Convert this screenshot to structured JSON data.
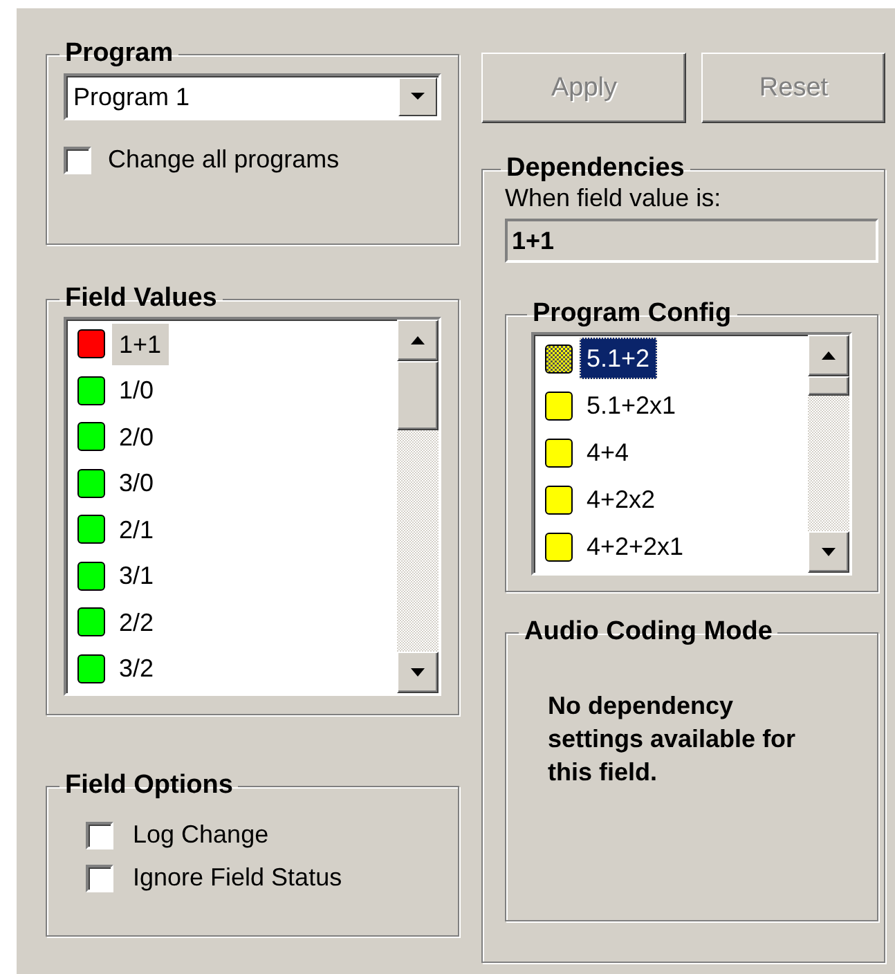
{
  "program": {
    "title": "Program",
    "dropdown_value": "Program 1",
    "change_all": {
      "label": "Change all programs",
      "checked": false
    }
  },
  "field_values": {
    "title": "Field Values",
    "items": [
      {
        "label": "1+1",
        "color": "#ff0000",
        "selected": true
      },
      {
        "label": "1/0",
        "color": "#00ff00",
        "selected": false
      },
      {
        "label": "2/0",
        "color": "#00ff00",
        "selected": false
      },
      {
        "label": "3/0",
        "color": "#00ff00",
        "selected": false
      },
      {
        "label": "2/1",
        "color": "#00ff00",
        "selected": false
      },
      {
        "label": "3/1",
        "color": "#00ff00",
        "selected": false
      },
      {
        "label": "2/2",
        "color": "#00ff00",
        "selected": false
      },
      {
        "label": "3/2",
        "color": "#00ff00",
        "selected": false
      }
    ]
  },
  "field_options": {
    "title": "Field Options",
    "options": [
      {
        "label": "Log Change",
        "checked": false
      },
      {
        "label": "Ignore Field Status",
        "checked": false
      }
    ]
  },
  "buttons": [
    {
      "label": "Apply",
      "disabled": true
    },
    {
      "label": "Reset",
      "disabled": true
    }
  ],
  "dependencies": {
    "title": "Dependencies",
    "field_label": "When field value is:",
    "field_value": "1+1",
    "program_config": {
      "title": "Program Config",
      "items": [
        {
          "label": "5.1+2",
          "color": "#ffff00",
          "selected": true
        },
        {
          "label": "5.1+2x1",
          "color": "#ffff00",
          "selected": false
        },
        {
          "label": "4+4",
          "color": "#ffff00",
          "selected": false
        },
        {
          "label": "4+2x2",
          "color": "#ffff00",
          "selected": false
        },
        {
          "label": "4+2+2x1",
          "color": "#ffff00",
          "selected": false
        }
      ]
    },
    "audio_coding_mode": {
      "title": "Audio Coding Mode",
      "message": "No dependency settings available for this field."
    }
  }
}
